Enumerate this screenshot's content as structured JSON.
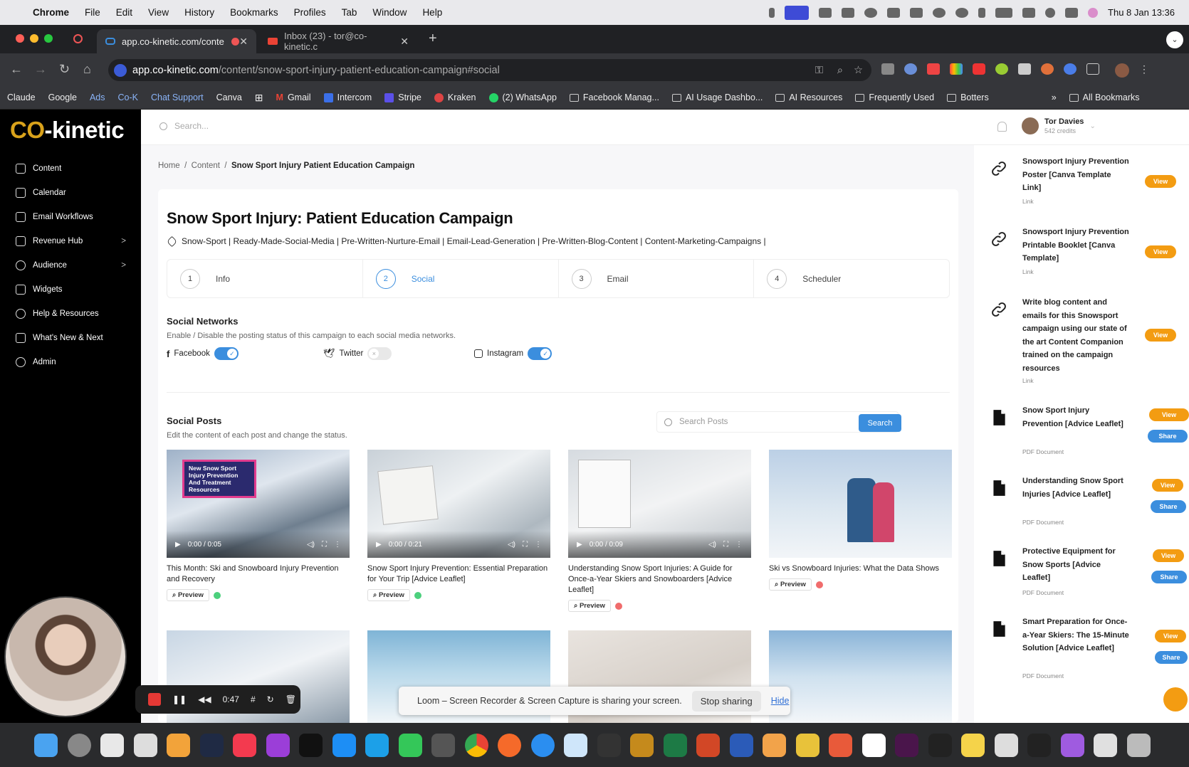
{
  "menubar": {
    "app": "Chrome",
    "items": [
      "File",
      "Edit",
      "View",
      "History",
      "Bookmarks",
      "Profiles",
      "Tab",
      "Window",
      "Help"
    ],
    "datetime": "Thu 8 Jan  13:36"
  },
  "tabs": [
    {
      "label": "app.co-kinetic.com/conte"
    },
    {
      "label": "Inbox (23) - tor@co-kinetic.c"
    }
  ],
  "omnibox": {
    "host": "app.co-kinetic.com",
    "path": "/content/snow-sport-injury-patient-education-campaign#social"
  },
  "bookmarks": [
    "Claude",
    "Google",
    "Ads",
    "Co-K",
    "Chat Support",
    "Canva",
    "Gmail",
    "Intercom",
    "Stripe",
    "Kraken",
    "(2) WhatsApp",
    "Facebook Manag...",
    "AI Usage Dashbo...",
    "AI Resources",
    "Frequently Used",
    "Botters",
    "All Bookmarks"
  ],
  "logo": {
    "pre": "C",
    "oo": "O",
    "post": "-kinetic"
  },
  "sidebar": {
    "items": [
      {
        "label": "Content"
      },
      {
        "label": "Calendar"
      },
      {
        "label": "Email Workflows"
      },
      {
        "label": "Revenue Hub",
        "chevron": ">"
      },
      {
        "label": "Audience",
        "chevron": ">"
      },
      {
        "label": "Widgets"
      },
      {
        "label": "Help & Resources"
      },
      {
        "label": "What's New & Next"
      },
      {
        "label": "Admin"
      }
    ]
  },
  "topbar": {
    "search_placeholder": "Search...",
    "user_name": "Tor Davies",
    "user_credits": "542 credits"
  },
  "breadcrumb": {
    "home": "Home",
    "sep": "/",
    "content": "Content",
    "current": "Snow Sport Injury Patient Education Campaign"
  },
  "campaign": {
    "title": "Snow Sport Injury: Patient Education Campaign",
    "tags": "Snow-Sport | Ready-Made-Social-Media | Pre-Written-Nurture-Email | Email-Lead-Generation | Pre-Written-Blog-Content | Content-Marketing-Campaigns |"
  },
  "steps": [
    {
      "num": "1",
      "label": "Info"
    },
    {
      "num": "2",
      "label": "Social"
    },
    {
      "num": "3",
      "label": "Email"
    },
    {
      "num": "4",
      "label": "Scheduler"
    }
  ],
  "social_networks": {
    "heading": "Social Networks",
    "desc": "Enable / Disable the posting status of this campaign to each social media networks.",
    "networks": [
      {
        "name": "Facebook",
        "enabled": true
      },
      {
        "name": "Twitter",
        "enabled": false
      },
      {
        "name": "Instagram",
        "enabled": true
      }
    ]
  },
  "social_posts": {
    "heading": "Social Posts",
    "desc": "Edit the content of each post and change the status.",
    "search_placeholder": "Search Posts",
    "search_button": "Search",
    "preview_label": "Preview",
    "posts": [
      {
        "title": "This Month: Ski and Snowboard Injury Prevention and Recovery",
        "time": "0:00 / 0:05",
        "overlay": "New Snow Sport Injury Prevention And Treatment Resources",
        "status_color": "#4cd07d"
      },
      {
        "title": "Snow Sport Injury Prevention: Essential Preparation for Your Trip [Advice Leaflet]",
        "time": "0:00 / 0:21",
        "status_color": "#4cd07d"
      },
      {
        "title": "Understanding Snow Sport Injuries: A Guide for Once-a-Year Skiers and Snowboarders [Advice Leaflet]",
        "time": "0:00 / 0:09",
        "status_color": "#f06c6c"
      },
      {
        "title": "Ski vs Snowboard Injuries: What the Data Shows",
        "status_color": "#f06c6c"
      }
    ]
  },
  "resources": [
    {
      "title": "Snowsport Injury Prevention Poster [Canva Template Link]",
      "sub": "Link",
      "type": "link"
    },
    {
      "title": "Snowsport Injury Prevention Printable Booklet [Canva Template]",
      "sub": "Link",
      "type": "link"
    },
    {
      "title": "Write blog content and emails for this Snowsport campaign using our state of the art Content Companion trained on the campaign resources",
      "sub": "Link",
      "type": "link"
    },
    {
      "title": "Snow Sport Injury Prevention [Advice Leaflet]",
      "sub": "PDF Document",
      "type": "pdf"
    },
    {
      "title": "Understanding Snow Sport Injuries [Advice Leaflet]",
      "sub": "PDF Document",
      "type": "pdf"
    },
    {
      "title": "Protective Equipment for Snow Sports [Advice Leaflet]",
      "sub": "PDF Document",
      "type": "pdf"
    },
    {
      "title": "Smart Preparation for Once-a-Year Skiers: The 15-Minute Solution [Advice Leaflet]",
      "sub": "PDF Document",
      "type": "pdf"
    }
  ],
  "resource_buttons": {
    "view": "View",
    "share": "Share"
  },
  "recorder": {
    "time": "0:47"
  },
  "share_bar": {
    "text": "Loom – Screen Recorder & Screen Capture is sharing your screen.",
    "stop": "Stop sharing",
    "hide": "Hide"
  },
  "colors": {
    "accent": "#3b8ede",
    "orange": "#f39c12",
    "sidebar_bg": "#000000",
    "logo_gold": "#d9a21b"
  }
}
